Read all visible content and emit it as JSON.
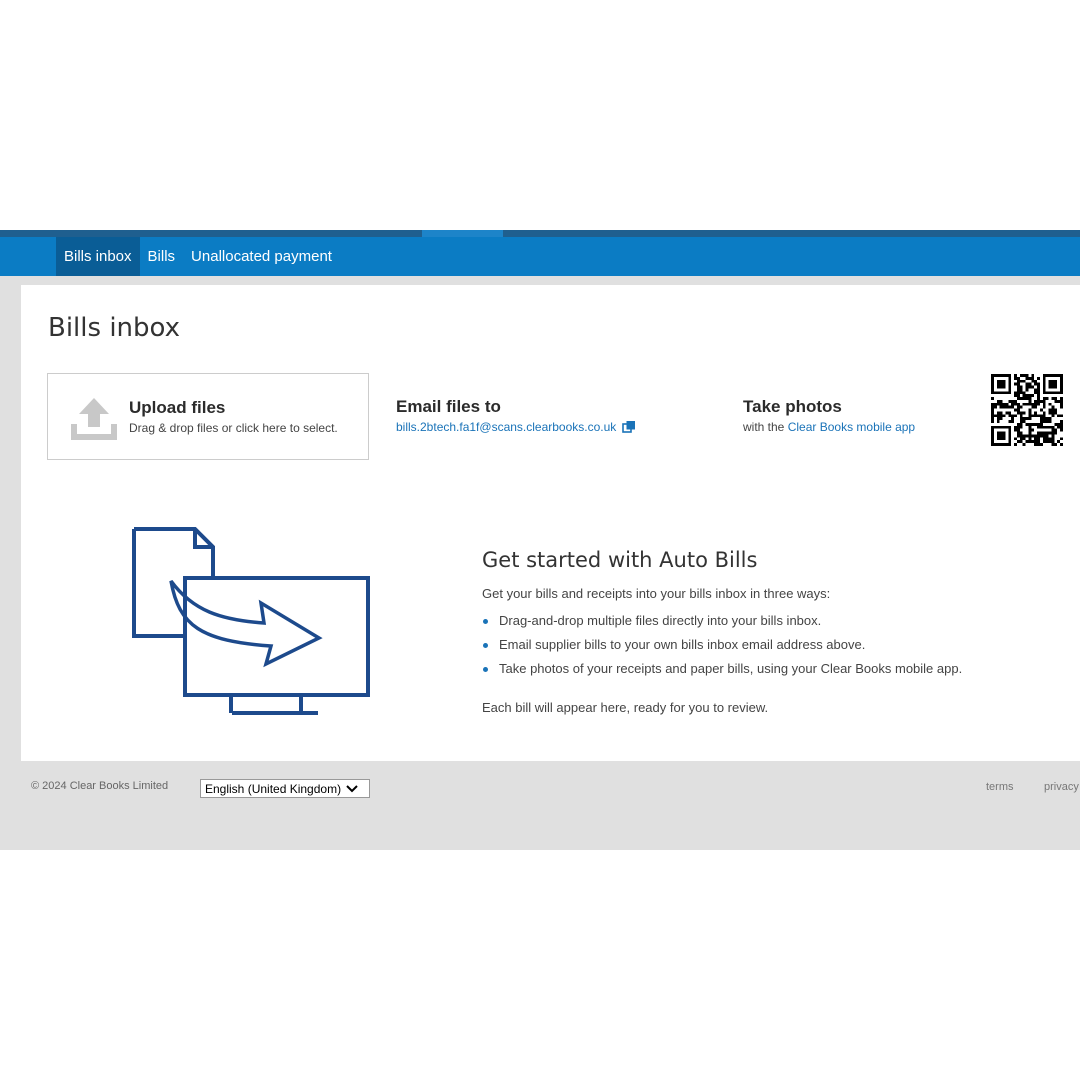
{
  "nav": {
    "items": [
      {
        "label": "Bills inbox",
        "active": true
      },
      {
        "label": "Bills",
        "active": false
      },
      {
        "label": "Unallocated payment",
        "active": false
      }
    ]
  },
  "page": {
    "title": "Bills inbox"
  },
  "options": {
    "upload": {
      "title": "Upload files",
      "subtitle": "Drag & drop files or click here to select.",
      "icon": "upload-icon"
    },
    "email": {
      "title": "Email files to",
      "address": "bills.2btech.fa1f@scans.clearbooks.co.uk",
      "icon": "copy-icon"
    },
    "photos": {
      "title": "Take photos",
      "prefix": "with the",
      "link_text": "Clear Books mobile app",
      "icon": "qr-code"
    }
  },
  "autobills": {
    "heading": "Get started with Auto Bills",
    "intro": "Get your bills and receipts into your bills inbox in three ways:",
    "steps": [
      "Drag-and-drop multiple files directly into your bills inbox.",
      "Email supplier bills to your own bills inbox email address above.",
      "Take photos of your receipts and paper bills, using your Clear Books mobile app."
    ],
    "outro": "Each bill will appear here, ready for you to review.",
    "illustration": "document-to-monitor-illustration"
  },
  "footer": {
    "copyright": "© 2024 Clear Books Limited",
    "language": "English (United Kingdom)",
    "links": [
      "terms",
      "privacy"
    ]
  },
  "colors": {
    "nav_bar": "#0b7cc4",
    "nav_active": "#0a5d96",
    "link": "#1a73b8",
    "illustration_stroke": "#1d4a8c",
    "page_background": "#e0e0e0"
  }
}
